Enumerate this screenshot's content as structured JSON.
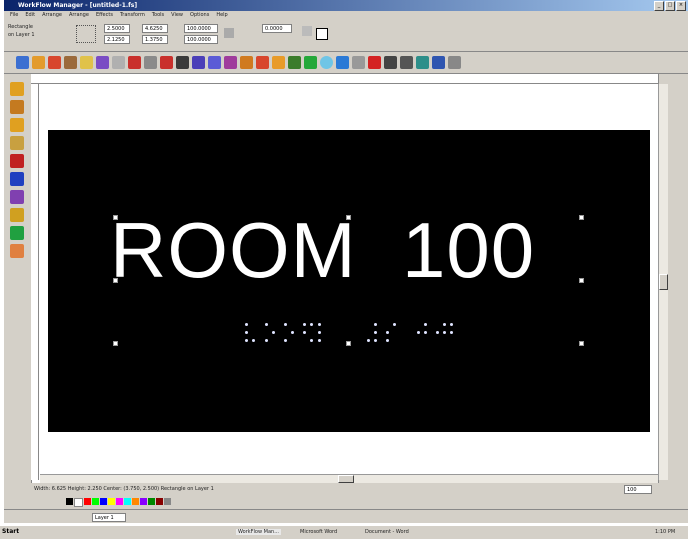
{
  "window": {
    "title": "WorkFlow Manager - [untitled-1.fs]",
    "min": "_",
    "max": "□",
    "close": "×"
  },
  "menu": [
    "File",
    "Edit",
    "Arrange",
    "Arrange",
    "Effects",
    "Transform",
    "Tools",
    "View",
    "Options",
    "Help"
  ],
  "propbar": {
    "obj_label_1": "Rectangle",
    "obj_label_2": "on Layer 1",
    "x": "2.5000",
    "y": "2.1250",
    "w": "4.6250",
    "h": "1.3750",
    "sx": "100.0000",
    "sy": "100.0000",
    "angle": "0.0000"
  },
  "sign": {
    "text": "ROOM  100"
  },
  "statusbar": {
    "info": "Width: 6.625  Height: 2.250  Center: (3.750, 2.500)   Rectangle on Layer 1",
    "layer": "Layer 1",
    "zoom": "100"
  },
  "taskbar": {
    "start": "Start",
    "tasks": [
      "WorkFlow Man...",
      "Microsoft Word",
      "Document - Word"
    ],
    "clock": "1:10 PM"
  }
}
